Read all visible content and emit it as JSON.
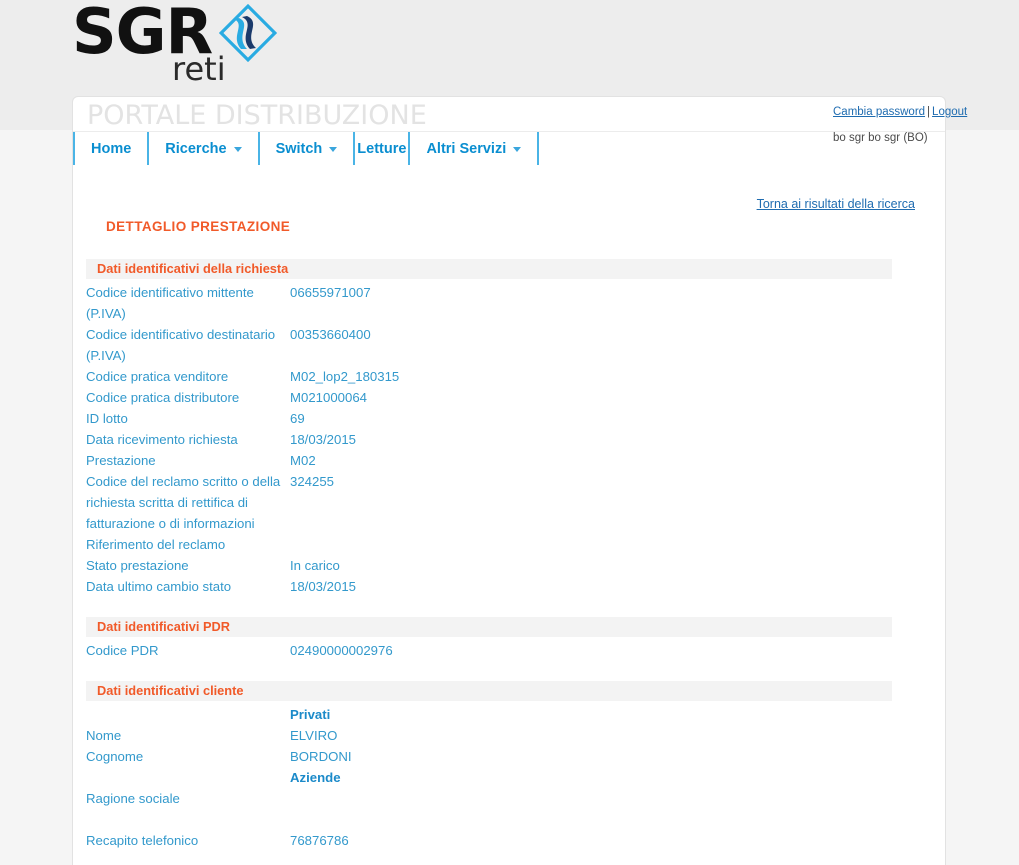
{
  "brand": {
    "name": "SGR",
    "subtitle": "reti",
    "logo_icon": "diamond-wave-logo",
    "mark_color_light": "#29ABE2",
    "mark_color_dark": "#1B3A6B"
  },
  "header": {
    "portal_title": "PORTALE DISTRIBUZIONE",
    "change_password_label": "Cambia password",
    "separator": "|",
    "logout_label": "Logout",
    "user_label": "bo sgr bo sgr (BO)"
  },
  "nav": {
    "items": [
      {
        "label": "Home",
        "has_caret": false
      },
      {
        "label": "Ricerche",
        "has_caret": true
      },
      {
        "label": "Switch",
        "has_caret": true
      },
      {
        "label": "Letture",
        "has_caret": false
      },
      {
        "label": "Altri Servizi",
        "has_caret": true
      }
    ]
  },
  "main": {
    "back_link_label": "Torna ai risultati della ricerca",
    "page_heading": "DETTAGLIO PRESTAZIONE",
    "accent_color": "#f15a29",
    "text_color": "#3399cc",
    "sections": [
      {
        "title": "Dati identificativi della richiesta",
        "rows": [
          {
            "label": "Codice identificativo mittente (P.IVA)",
            "value": "06655971007"
          },
          {
            "label": "Codice identificativo destinatario (P.IVA)",
            "value": "00353660400"
          },
          {
            "label": "Codice pratica venditore",
            "value": "M02_lop2_180315"
          },
          {
            "label": "Codice pratica distributore",
            "value": "M021000064"
          },
          {
            "label": "ID lotto",
            "value": "69"
          },
          {
            "label": "Data ricevimento richiesta",
            "value": "18/03/2015"
          },
          {
            "label": "Prestazione",
            "value": "M02"
          },
          {
            "label": "Codice del reclamo scritto o della richiesta scritta di rettifica di fatturazione o di informazioni",
            "value": "324255"
          },
          {
            "label": "Riferimento del reclamo",
            "value": ""
          },
          {
            "label": "Stato prestazione",
            "value": "In carico"
          },
          {
            "label": "Data ultimo cambio stato",
            "value": "18/03/2015"
          }
        ]
      },
      {
        "title": "Dati identificativi PDR",
        "rows": [
          {
            "label": "Codice PDR",
            "value": "02490000002976"
          }
        ]
      },
      {
        "title": "Dati identificativi cliente",
        "rows": [
          {
            "label": "",
            "value": "Privati",
            "subhead": true
          },
          {
            "label": "Nome",
            "value": "ELVIRO"
          },
          {
            "label": "Cognome",
            "value": "BORDONI"
          },
          {
            "label": "",
            "value": "Aziende",
            "subhead": true
          },
          {
            "label": "Ragione sociale",
            "value": ""
          },
          {
            "label": "",
            "value": ""
          },
          {
            "label": "Recapito telefonico",
            "value": "76876786"
          }
        ]
      }
    ]
  }
}
